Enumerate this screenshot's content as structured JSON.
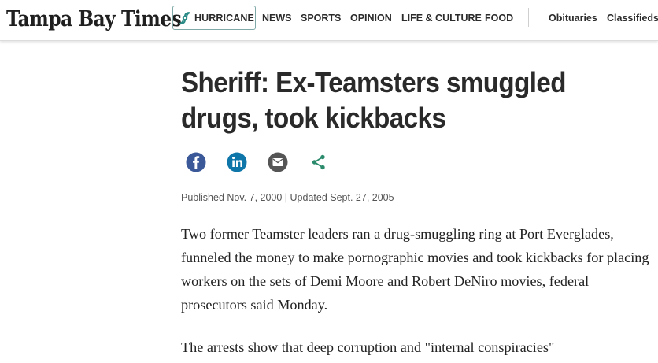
{
  "header": {
    "logo_text": "Tampa Bay Times",
    "hurricane_label": "HURRICANE",
    "hurricane_icon": "hurricane-icon",
    "accent_color": "#2a8a85",
    "nav": [
      "NEWS",
      "SPORTS",
      "OPINION",
      "LIFE & CULTURE",
      "FOOD"
    ],
    "utility": [
      "Obituaries",
      "Classifieds"
    ]
  },
  "article": {
    "headline": "Sheriff: Ex-Teamsters smuggled drugs, took kickbacks",
    "share": [
      {
        "icon": "facebook-icon",
        "color": "#3b5998"
      },
      {
        "icon": "linkedin-icon",
        "color": "#0e76a8"
      },
      {
        "icon": "email-icon",
        "color": "#555555"
      },
      {
        "icon": "share-icon",
        "color": "#2a8a6b"
      }
    ],
    "dateline": "Published Nov. 7, 2000 | Updated Sept. 27, 2005",
    "paragraphs": [
      "Two former Teamster leaders ran a drug-smuggling ring at Port Everglades, funneled the money to make pornographic movies and took kickbacks for placing workers on the sets of Demi Moore and Robert DeNiro movies, federal prosecutors said Monday.",
      "The arrests show that deep corruption and \"internal conspiracies\""
    ]
  }
}
